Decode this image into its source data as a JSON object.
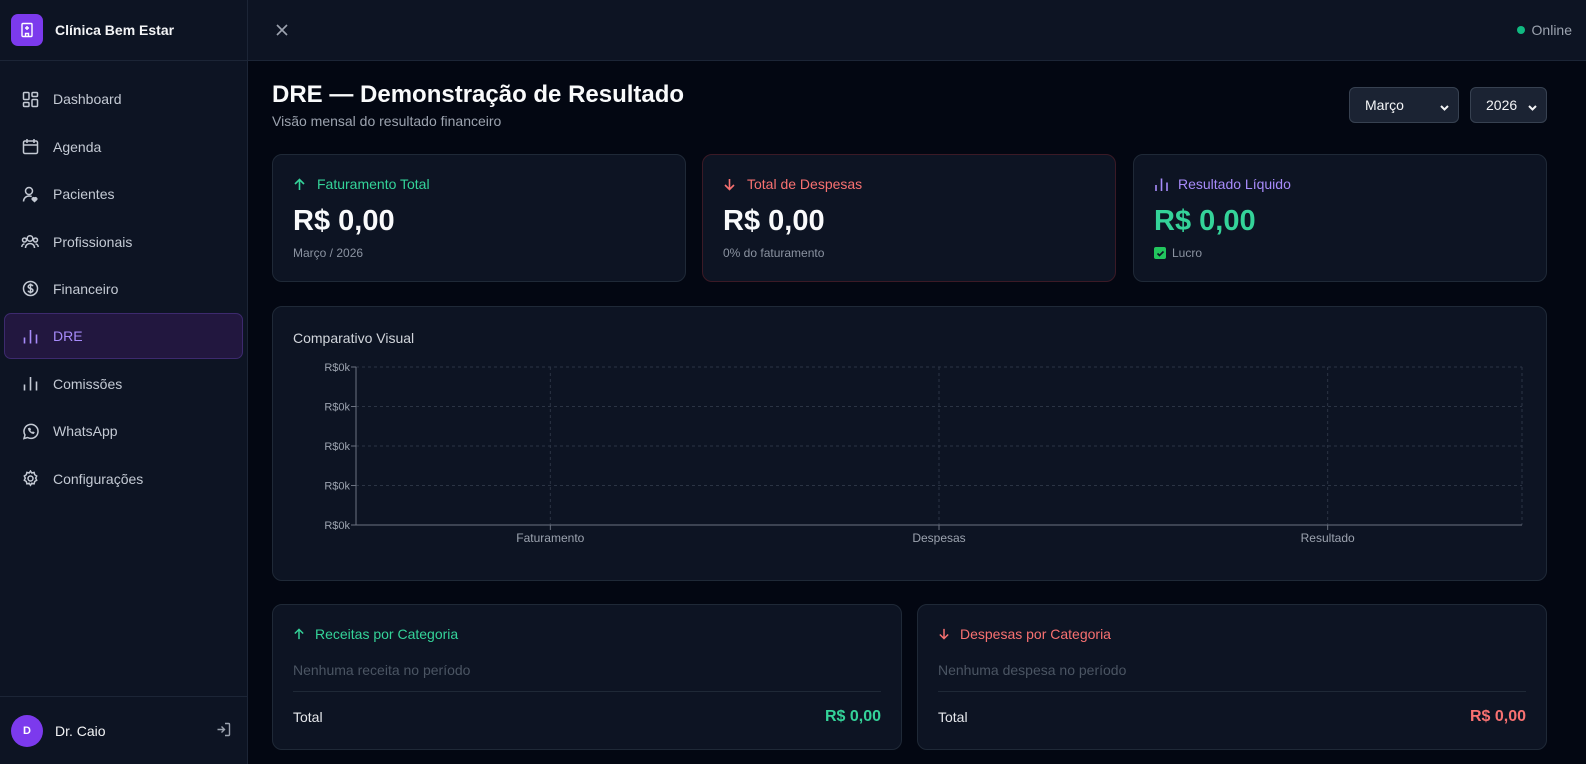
{
  "app": {
    "name": "Clínica Bem Estar"
  },
  "sidebar": {
    "items": [
      {
        "label": "Dashboard",
        "icon": "dashboard-icon"
      },
      {
        "label": "Agenda",
        "icon": "calendar-icon"
      },
      {
        "label": "Pacientes",
        "icon": "patient-icon"
      },
      {
        "label": "Profissionais",
        "icon": "users-icon"
      },
      {
        "label": "Financeiro",
        "icon": "dollar-icon"
      },
      {
        "label": "DRE",
        "icon": "bar-chart-icon",
        "active": true
      },
      {
        "label": "Comissões",
        "icon": "bar-chart-icon"
      },
      {
        "label": "WhatsApp",
        "icon": "whatsapp-icon"
      },
      {
        "label": "Configurações",
        "icon": "gear-icon"
      }
    ],
    "user": {
      "initial": "D",
      "name": "Dr. Caio"
    }
  },
  "topbar": {
    "status": "Online"
  },
  "page": {
    "title": "DRE — Demonstração de Resultado",
    "subtitle": "Visão mensal do resultado financeiro",
    "month": "Março",
    "year": "2026"
  },
  "kpis": {
    "revenue": {
      "label": "Faturamento Total",
      "value": "R$ 0,00",
      "sub": "Março / 2026"
    },
    "expenses": {
      "label": "Total de Despesas",
      "value": "R$ 0,00",
      "sub": "0% do faturamento"
    },
    "net": {
      "label": "Resultado Líquido",
      "value": "R$ 0,00",
      "sub": "Lucro"
    }
  },
  "chart": {
    "title": "Comparativo Visual"
  },
  "chart_data": {
    "type": "bar",
    "categories": [
      "Faturamento",
      "Despesas",
      "Resultado"
    ],
    "values": [
      0,
      0,
      0
    ],
    "yticks": [
      "R$0k",
      "R$0k",
      "R$0k",
      "R$0k",
      "R$0k"
    ],
    "grid": true
  },
  "categories": {
    "income": {
      "title": "Receitas por Categoria",
      "empty": "Nenhuma receita no período",
      "total_label": "Total",
      "total": "R$ 0,00"
    },
    "expenses": {
      "title": "Despesas por Categoria",
      "empty": "Nenhuma despesa no período",
      "total_label": "Total",
      "total": "R$ 0,00"
    }
  },
  "colors": {
    "accent": "#7c3aed",
    "positive": "#34d399",
    "negative": "#f87171",
    "purple": "#a78bfa"
  }
}
